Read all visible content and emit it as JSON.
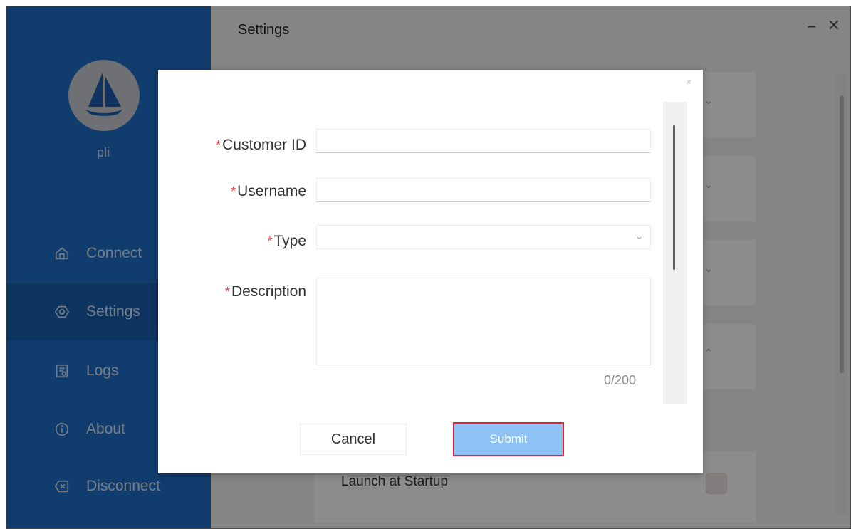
{
  "window": {
    "title": "Settings",
    "minimize": "−",
    "close": "✕"
  },
  "sidebar": {
    "username": "pli",
    "items": [
      {
        "label": "Connect",
        "icon": "home-icon"
      },
      {
        "label": "Settings",
        "icon": "gear-icon",
        "active": true
      },
      {
        "label": "Logs",
        "icon": "log-icon"
      },
      {
        "label": "About",
        "icon": "info-icon"
      },
      {
        "label": "Disconnect",
        "icon": "disconnect-icon"
      }
    ]
  },
  "background": {
    "launch_label": "Launch at Startup"
  },
  "dialog": {
    "close": "×",
    "required_mark": "*",
    "fields": {
      "customer_id": {
        "label": "Customer ID",
        "value": ""
      },
      "username": {
        "label": "Username",
        "value": ""
      },
      "type": {
        "label": "Type",
        "value": ""
      },
      "description": {
        "label": "Description",
        "value": "",
        "count": "0/200"
      }
    },
    "cancel_label": "Cancel",
    "submit_label": "Submit"
  },
  "colors": {
    "sidebar": "#1f6fc8",
    "accent": "#8cc2f5",
    "required": "#e23c3c",
    "highlight": "#d9263a"
  }
}
